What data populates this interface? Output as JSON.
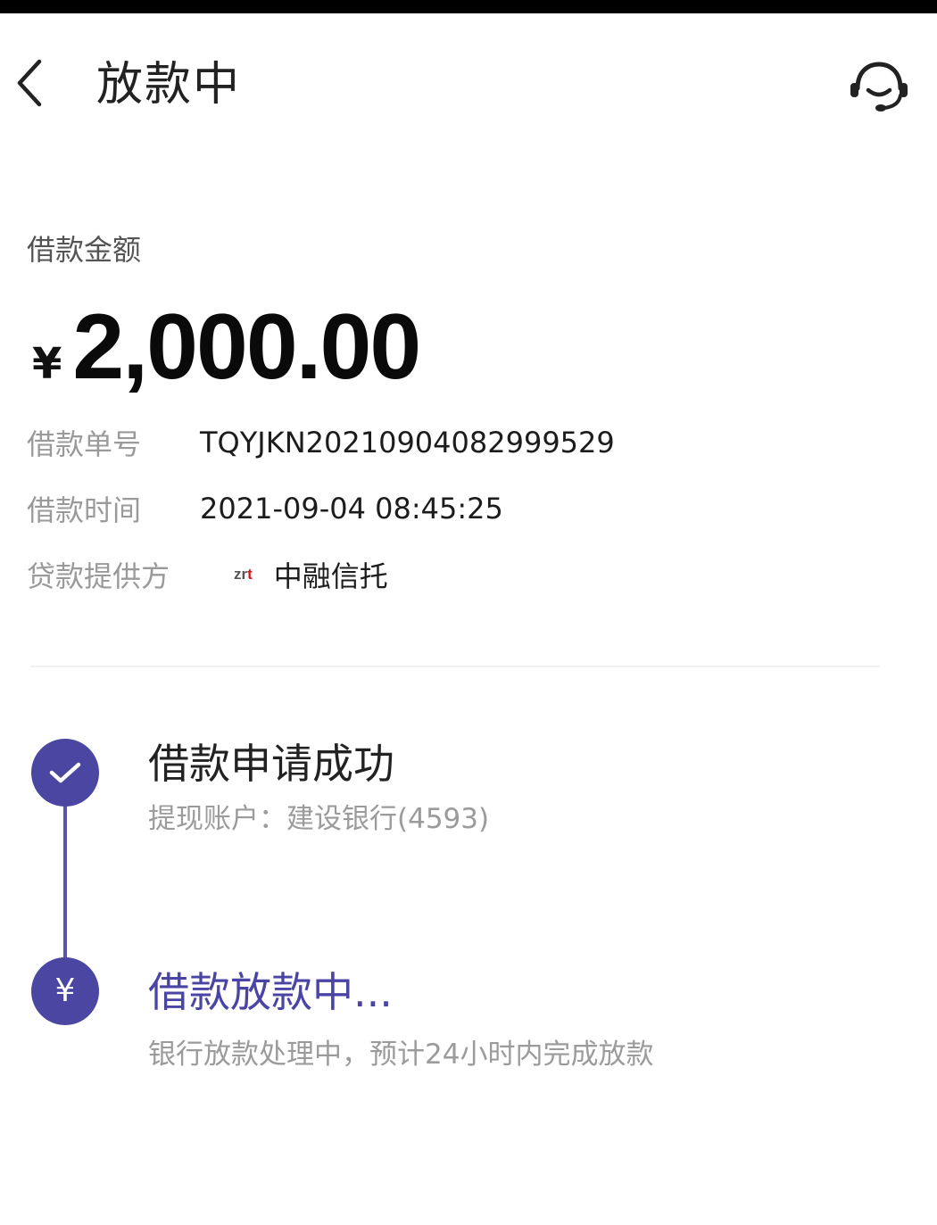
{
  "header": {
    "title": "放款中",
    "back_icon": "chevron-left-icon",
    "support_icon": "headset-icon"
  },
  "loan": {
    "amount_label": "借款金额",
    "currency": "¥",
    "amount": "2,000.00",
    "order_label": "借款单号",
    "order_number": "TQYJKN20210904082999529",
    "time_label": "借款时间",
    "time": "2021-09-04 08:45:25",
    "provider_label": "贷款提供方",
    "provider_logo_text_a": "zr",
    "provider_logo_text_b": "t",
    "provider_name": "中融信托"
  },
  "timeline": {
    "steps": [
      {
        "title": "借款申请成功",
        "subtitle": "提现账户：建设银行(4593)",
        "icon": "check-icon",
        "status": "completed"
      },
      {
        "title": "借款放款中...",
        "subtitle": "银行放款处理中，预计24小时内完成放款",
        "icon": "yen-icon",
        "status": "in-progress"
      }
    ]
  },
  "colors": {
    "accent": "#4b46a2",
    "accent_text": "#4a45a5",
    "label_gray": "#9a9a9a",
    "logo_red": "#d0191f"
  }
}
